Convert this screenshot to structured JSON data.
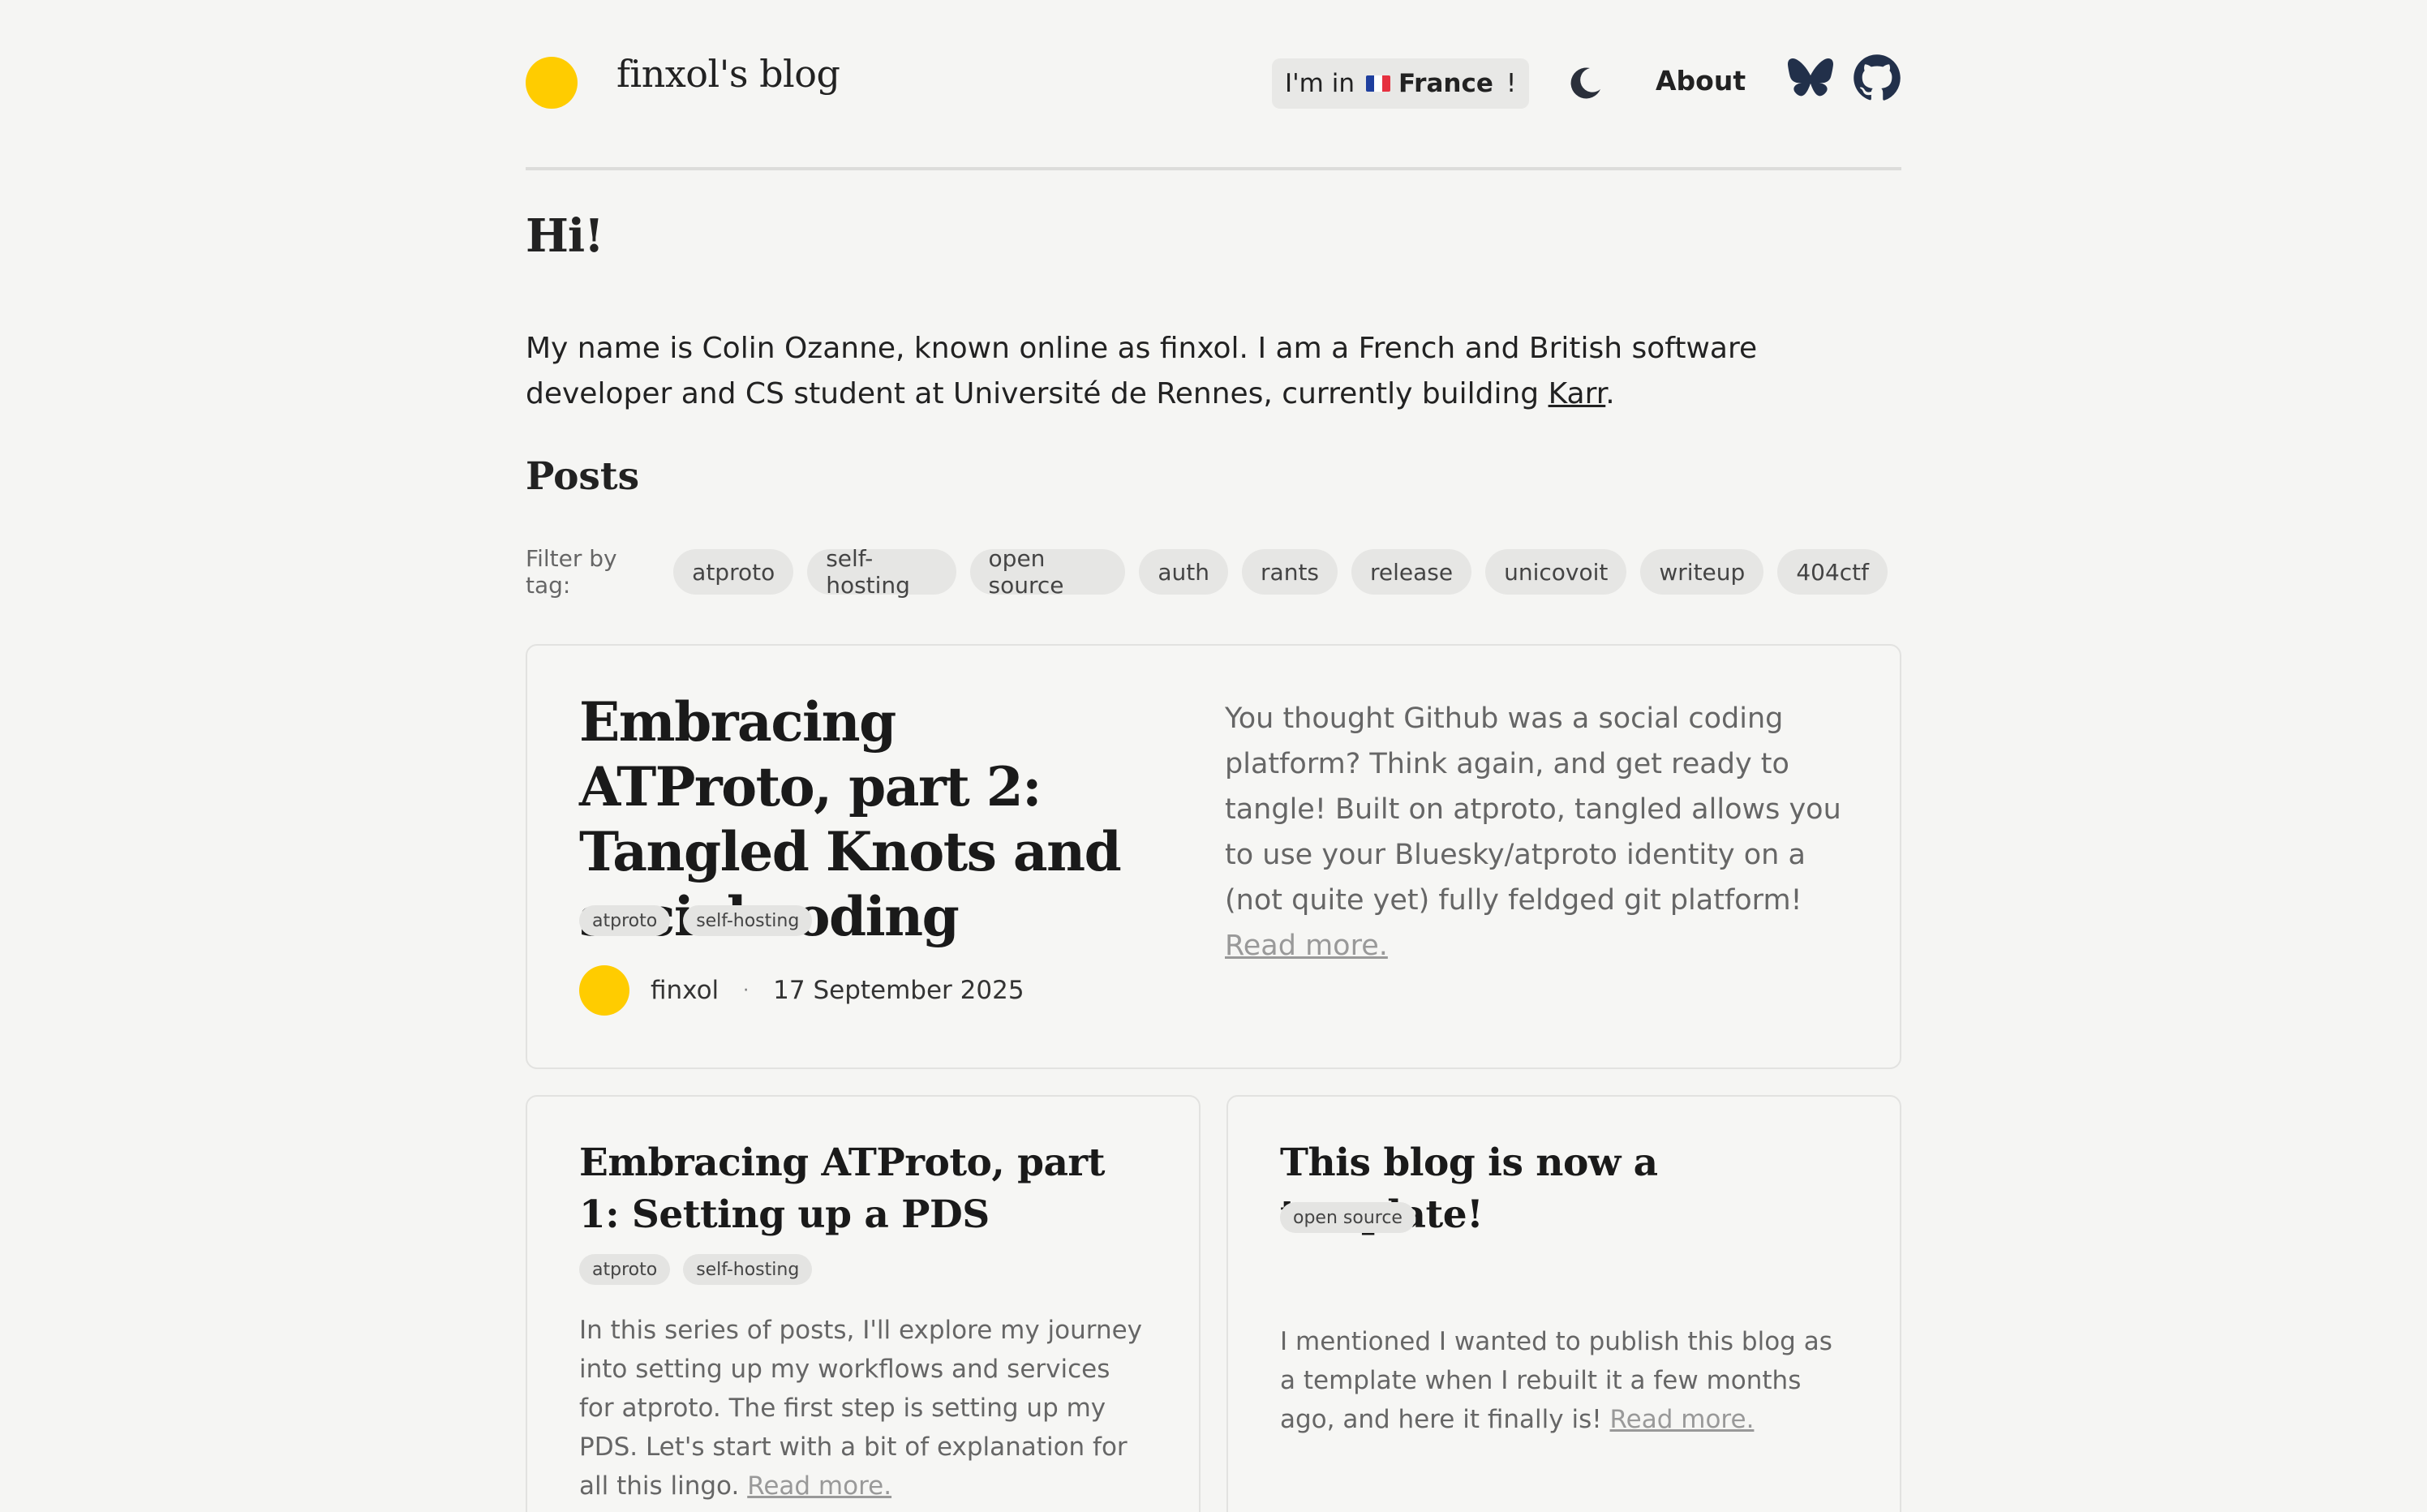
{
  "colors": {
    "accent": "#ffcc00",
    "background": "#f5f5f3"
  },
  "header": {
    "site_title": "finxol's blog",
    "location_prefix": "I'm in",
    "location_country": "France",
    "location_suffix": "!",
    "nav_about": "About",
    "icons": [
      "moon-icon",
      "bluesky-butterfly-icon",
      "github-icon"
    ]
  },
  "intro": {
    "greeting": "Hi!",
    "text_before_link": "My name is Colin Ozanne, known online as finxol. I am a French and British software developer and CS student at Université de Rennes, currently building ",
    "link_text": "Karr",
    "text_after_link": "."
  },
  "posts": {
    "heading": "Posts",
    "filter_label": "Filter by tag:",
    "filter_tags": [
      "atproto",
      "self-hosting",
      "open source",
      "auth",
      "rants",
      "release",
      "unicovoit",
      "writeup",
      "404ctf"
    ],
    "read_more": "Read more.",
    "featured": {
      "title": "Embracing ATProto, part 2: Tangled Knots and social coding",
      "tags": [
        "atproto",
        "self-hosting"
      ],
      "author": "finxol",
      "separator": "·",
      "date": "17 September 2025",
      "excerpt": "You thought Github was a social coding platform? Think again, and get ready to tangle! Built on atproto, tangled allows you to use your Bluesky/atproto identity on a (not quite yet) fully feldged git platform!"
    },
    "list": [
      {
        "title": "Embracing ATProto, part 1: Setting up a PDS",
        "tags": [
          "atproto",
          "self-hosting"
        ],
        "excerpt": "In this series of posts, I'll explore my journey into setting up my workflows and services for atproto. The first step is setting up my PDS. Let's start with a bit of explanation for all this lingo."
      },
      {
        "title": "This blog is now a template!",
        "tags": [
          "open source"
        ],
        "excerpt": "I mentioned I wanted to publish this blog as a template when I rebuilt it a few months ago, and here it finally is!"
      }
    ]
  }
}
